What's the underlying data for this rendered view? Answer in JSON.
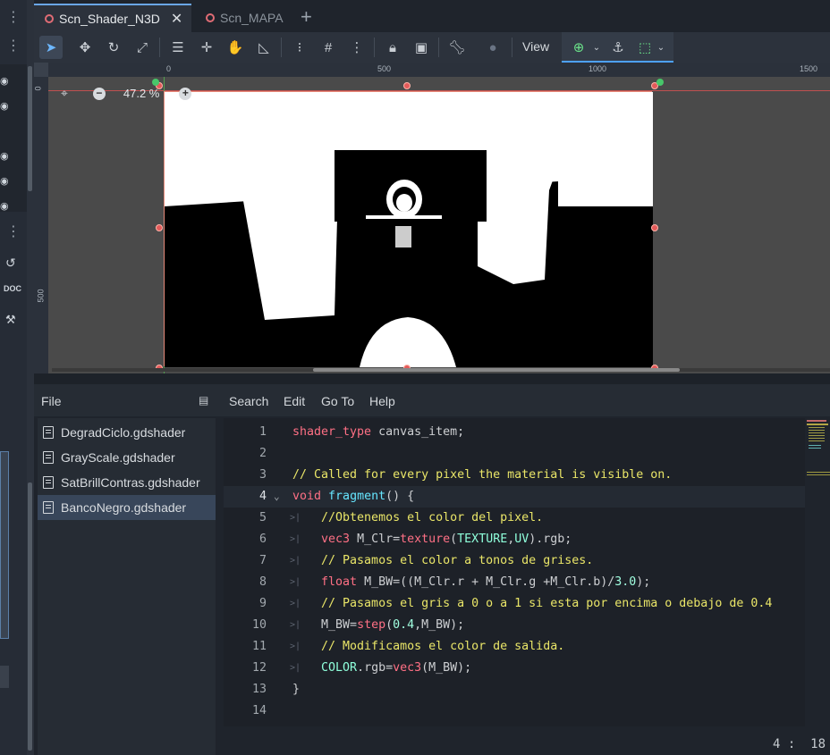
{
  "tabs": [
    {
      "label": "Scn_Shader_N3D",
      "active": true
    },
    {
      "label": "Scn_MAPA",
      "active": false
    }
  ],
  "toolbar": {
    "view_label": "View"
  },
  "viewport": {
    "zoom_label": "47.2 %",
    "ruler_top": [
      "0",
      "500",
      "1000",
      "1500"
    ],
    "ruler_left": [
      "0",
      "500"
    ]
  },
  "script_menu": {
    "file": "File",
    "search": "Search",
    "edit": "Edit",
    "goto": "Go To",
    "help": "Help"
  },
  "files": [
    {
      "name": "DegradCiclo.gdshader",
      "selected": false
    },
    {
      "name": "GrayScale.gdshader",
      "selected": false
    },
    {
      "name": "SatBrillContras.gdshader",
      "selected": false
    },
    {
      "name": "BancoNegro.gdshader",
      "selected": true
    }
  ],
  "code_lines": [
    "1",
    "2",
    "3",
    "4",
    "5",
    "6",
    "7",
    "8",
    "9",
    "10",
    "11",
    "12",
    "13",
    "14"
  ],
  "status": {
    "cursor": "4 :  18"
  },
  "colors": {
    "accent": "#4ea1ff",
    "editor_bg": "#1d2128",
    "canvas_border": "#e58a7a"
  }
}
